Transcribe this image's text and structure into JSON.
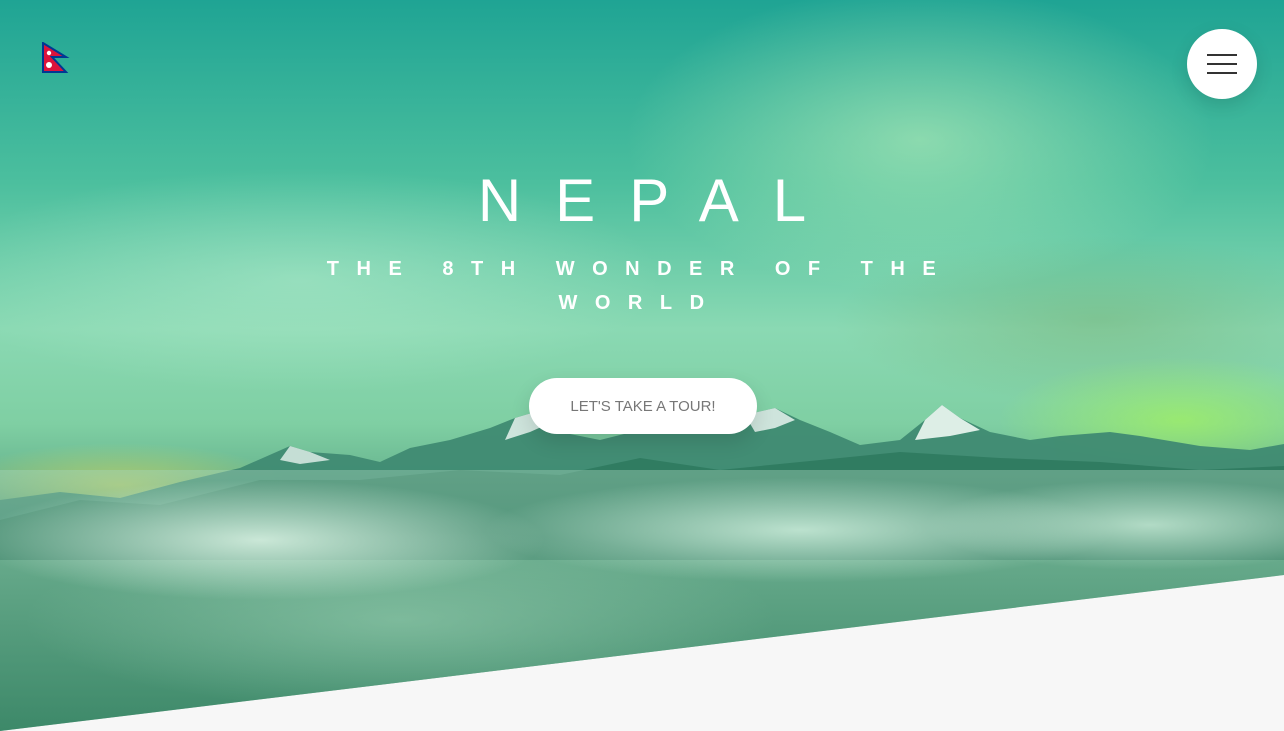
{
  "hero": {
    "title": "NEPAL",
    "subtitle": "THE 8TH WONDER OF THE WORLD",
    "cta_label": "LET'S TAKE A TOUR!"
  },
  "header": {
    "logo_icon": "nepal-flag-icon",
    "menu_icon": "hamburger-menu-icon"
  },
  "colors": {
    "overlay_teal": "#1fa494",
    "overlay_green": "#7fcfa3",
    "button_bg": "#ffffff",
    "button_text": "#777777",
    "footer_bg": "#f7f7f7",
    "flag_red": "#dc143c",
    "flag_blue": "#003893"
  }
}
